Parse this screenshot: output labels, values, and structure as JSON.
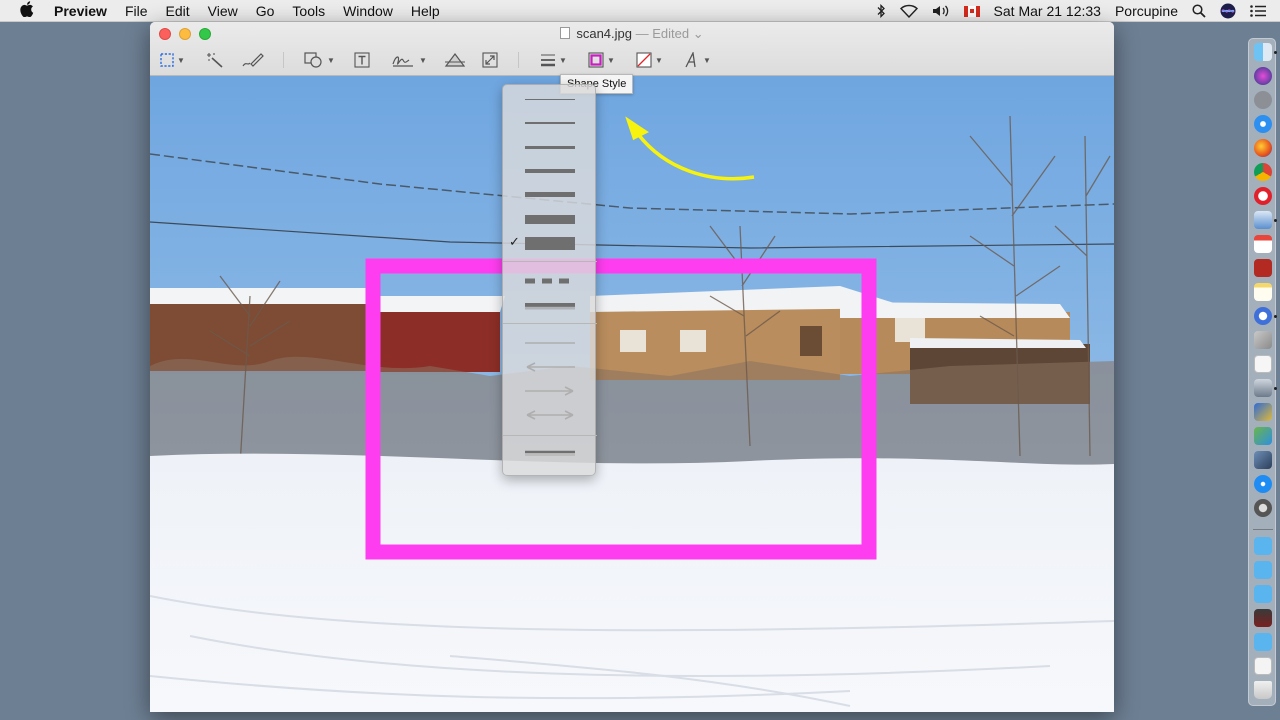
{
  "menubar": {
    "apple": "",
    "items": [
      "Preview",
      "File",
      "Edit",
      "View",
      "Go",
      "Tools",
      "Window",
      "Help"
    ],
    "clock": "Sat Mar 21  12:33",
    "user": "Porcupine"
  },
  "window": {
    "filename": "scan4.jpg",
    "edited": "— Edited"
  },
  "toolbar": {
    "tools": [
      "rectangular-selection",
      "instant-alpha",
      "sketch",
      "shapes",
      "text",
      "sign",
      "adjust-color",
      "adjust-size",
      "shape-style",
      "border-color",
      "fill-color",
      "text-style"
    ]
  },
  "tooltip": {
    "text": "Shape Style"
  },
  "shape_style_menu": {
    "line_weights_label_selected": "✓",
    "selected_index": 6
  },
  "annotations": {
    "rectangle_color": "#ff3df0",
    "arrow_color": "#f7f20e"
  },
  "dock": {
    "apps": [
      "finder",
      "siri",
      "launchpad",
      "safari",
      "firefox",
      "chrome",
      "opera",
      "preview",
      "calendar",
      "acrobat",
      "notes",
      "pycharm",
      "photos",
      "textedit",
      "scanner",
      "keynote",
      "image-capture",
      "iphoto",
      "app-store",
      "system-preferences",
      "folder",
      "folder",
      "folder",
      "photo-booth",
      "folder",
      "document",
      "trash"
    ]
  }
}
